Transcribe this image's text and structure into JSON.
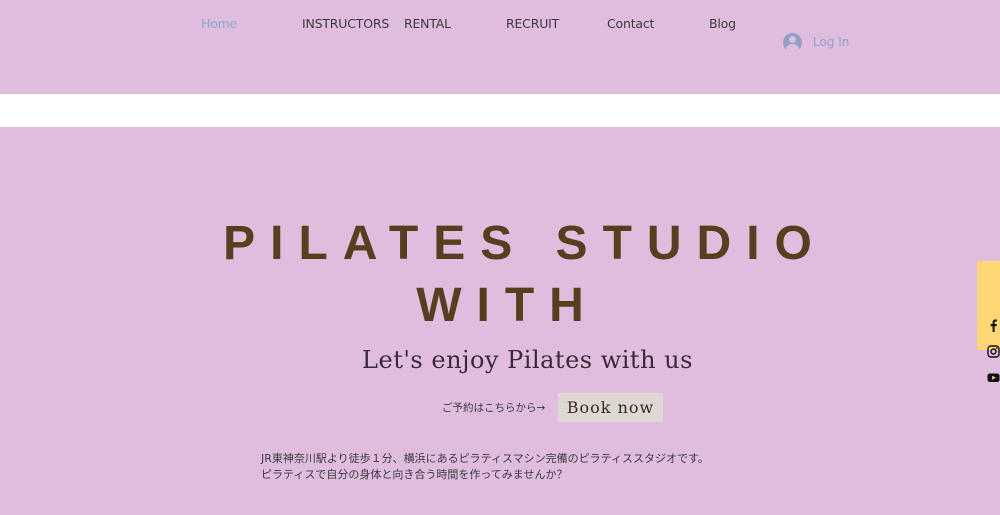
{
  "nav": {
    "items": [
      {
        "label": "Home",
        "active": true
      },
      {
        "label": "INSTRUCTORS",
        "active": false
      },
      {
        "label": "RENTAL",
        "active": false
      },
      {
        "label": "RECRUIT",
        "active": false
      },
      {
        "label": "Contact",
        "active": false
      },
      {
        "label": "Blog",
        "active": false
      }
    ],
    "login_label": "Log In"
  },
  "hero": {
    "title_line1": "PILATES STUDIO",
    "title_line2": "WITH",
    "subtitle": "Let's enjoy Pilates with us",
    "reserve_note": "ご予約はこちらから→",
    "book_label": "Book now",
    "description_line1": "JR東神奈川駅より徒歩１分、横浜にあるピラティスマシン完備のピラティススタジオです。",
    "description_line2": "ピラティスで自分の身体と向き合う時間を作ってみませんか？"
  },
  "social": {
    "icons": [
      "facebook-icon",
      "instagram-icon",
      "youtube-icon"
    ]
  },
  "colors": {
    "background": "#e0bddf",
    "title": "#553f1c",
    "nav_active": "#8fa6c9",
    "social_bar": "#fcd774",
    "book_button": "#ddd8d3"
  }
}
